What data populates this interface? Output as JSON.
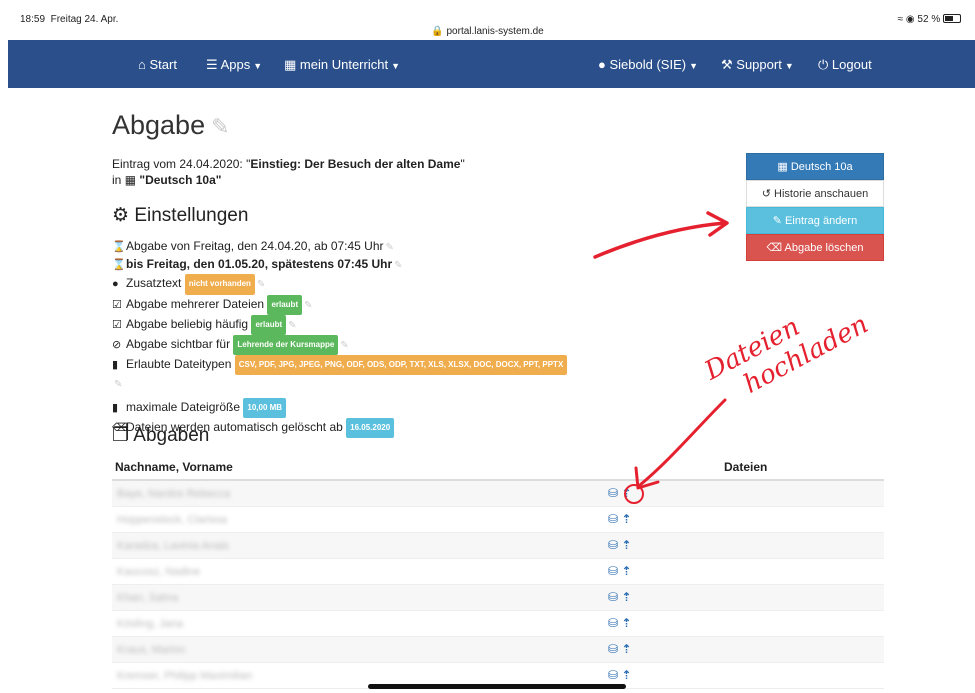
{
  "status": {
    "time": "18:59",
    "date": "Freitag 24. Apr.",
    "url": "portal.lanis-system.de",
    "battery": "52 %",
    "battery_level": 0.52
  },
  "nav": {
    "start": "Start",
    "apps": "Apps",
    "unterricht": "mein Unterricht",
    "user": "Siebold (SIE)",
    "support": "Support",
    "logout": "Logout"
  },
  "page": {
    "title": "Abgabe",
    "entry_prefix": "Eintrag vom 24.04.2020: \"",
    "entry_title": "Einstieg: Der Besuch der alten Dame",
    "entry_suffix": "\"",
    "in_prefix": "in",
    "course": "\"Deutsch 10a\""
  },
  "settings": {
    "heading": "Einstellungen",
    "from": "Abgabe von Freitag, den 24.04.20, ab 07:45 Uhr",
    "until": "bis Freitag, den 01.05.20, spätestens 07:45 Uhr",
    "extra_label": "Zusatztext",
    "extra_badge": "nicht vorhanden",
    "multi_label": "Abgabe mehrerer Dateien",
    "multi_badge": "erlaubt",
    "often_label": "Abgabe beliebig häufig",
    "often_badge": "erlaubt",
    "visible_label": "Abgabe sichtbar für",
    "visible_badge": "Lehrende der Kursmappe",
    "types_label": "Erlaubte Dateitypen",
    "types_badge": "CSV, PDF, JPG, JPEG, PNG, ODF, ODS, ODP, TXT, XLS, XLSX, DOC, DOCX, PPT, PPTX",
    "size_label": "maximale Dateigröße",
    "size_badge": "10,00 MB",
    "delete_label": "Dateien werden automatisch gelöscht ab",
    "delete_badge": "16.05.2020"
  },
  "side": {
    "course": "Deutsch 10a",
    "history": "Historie anschauen",
    "edit": "Eintrag ändern",
    "delete": "Abgabe löschen"
  },
  "abgaben": {
    "heading": "Abgaben",
    "col_name": "Nachname, Vorname",
    "col_files": "Dateien",
    "rows": [
      "Baye, Nardos Rebecca",
      "Hoppenstock, Clarissa",
      "Karadza, Lavinia Anais",
      "Kaucosz, Nadine",
      "Khan, Sahra",
      "Kösling, Jana",
      "Kraus, Marlon",
      "Kremser, Philipp Maximilian"
    ]
  },
  "annotation": {
    "text_line1": "Dateien",
    "text_line2": "hochladen"
  }
}
